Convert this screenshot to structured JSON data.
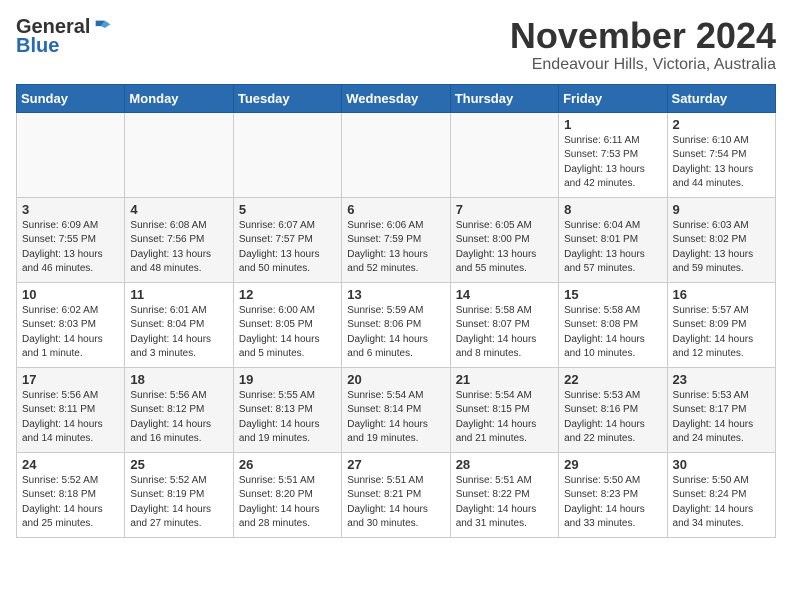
{
  "header": {
    "logo": {
      "general": "General",
      "blue": "Blue",
      "tagline": "GeneralBlue"
    },
    "title": "November 2024",
    "location": "Endeavour Hills, Victoria, Australia"
  },
  "weekdays": [
    "Sunday",
    "Monday",
    "Tuesday",
    "Wednesday",
    "Thursday",
    "Friday",
    "Saturday"
  ],
  "weeks": [
    [
      {
        "day": "",
        "info": ""
      },
      {
        "day": "",
        "info": ""
      },
      {
        "day": "",
        "info": ""
      },
      {
        "day": "",
        "info": ""
      },
      {
        "day": "",
        "info": ""
      },
      {
        "day": "1",
        "info": "Sunrise: 6:11 AM\nSunset: 7:53 PM\nDaylight: 13 hours\nand 42 minutes."
      },
      {
        "day": "2",
        "info": "Sunrise: 6:10 AM\nSunset: 7:54 PM\nDaylight: 13 hours\nand 44 minutes."
      }
    ],
    [
      {
        "day": "3",
        "info": "Sunrise: 6:09 AM\nSunset: 7:55 PM\nDaylight: 13 hours\nand 46 minutes."
      },
      {
        "day": "4",
        "info": "Sunrise: 6:08 AM\nSunset: 7:56 PM\nDaylight: 13 hours\nand 48 minutes."
      },
      {
        "day": "5",
        "info": "Sunrise: 6:07 AM\nSunset: 7:57 PM\nDaylight: 13 hours\nand 50 minutes."
      },
      {
        "day": "6",
        "info": "Sunrise: 6:06 AM\nSunset: 7:59 PM\nDaylight: 13 hours\nand 52 minutes."
      },
      {
        "day": "7",
        "info": "Sunrise: 6:05 AM\nSunset: 8:00 PM\nDaylight: 13 hours\nand 55 minutes."
      },
      {
        "day": "8",
        "info": "Sunrise: 6:04 AM\nSunset: 8:01 PM\nDaylight: 13 hours\nand 57 minutes."
      },
      {
        "day": "9",
        "info": "Sunrise: 6:03 AM\nSunset: 8:02 PM\nDaylight: 13 hours\nand 59 minutes."
      }
    ],
    [
      {
        "day": "10",
        "info": "Sunrise: 6:02 AM\nSunset: 8:03 PM\nDaylight: 14 hours\nand 1 minute."
      },
      {
        "day": "11",
        "info": "Sunrise: 6:01 AM\nSunset: 8:04 PM\nDaylight: 14 hours\nand 3 minutes."
      },
      {
        "day": "12",
        "info": "Sunrise: 6:00 AM\nSunset: 8:05 PM\nDaylight: 14 hours\nand 5 minutes."
      },
      {
        "day": "13",
        "info": "Sunrise: 5:59 AM\nSunset: 8:06 PM\nDaylight: 14 hours\nand 6 minutes."
      },
      {
        "day": "14",
        "info": "Sunrise: 5:58 AM\nSunset: 8:07 PM\nDaylight: 14 hours\nand 8 minutes."
      },
      {
        "day": "15",
        "info": "Sunrise: 5:58 AM\nSunset: 8:08 PM\nDaylight: 14 hours\nand 10 minutes."
      },
      {
        "day": "16",
        "info": "Sunrise: 5:57 AM\nSunset: 8:09 PM\nDaylight: 14 hours\nand 12 minutes."
      }
    ],
    [
      {
        "day": "17",
        "info": "Sunrise: 5:56 AM\nSunset: 8:11 PM\nDaylight: 14 hours\nand 14 minutes."
      },
      {
        "day": "18",
        "info": "Sunrise: 5:56 AM\nSunset: 8:12 PM\nDaylight: 14 hours\nand 16 minutes."
      },
      {
        "day": "19",
        "info": "Sunrise: 5:55 AM\nSunset: 8:13 PM\nDaylight: 14 hours\nand 19 minutes."
      },
      {
        "day": "20",
        "info": "Sunrise: 5:54 AM\nSunset: 8:14 PM\nDaylight: 14 hours\nand 19 minutes."
      },
      {
        "day": "21",
        "info": "Sunrise: 5:54 AM\nSunset: 8:15 PM\nDaylight: 14 hours\nand 21 minutes."
      },
      {
        "day": "22",
        "info": "Sunrise: 5:53 AM\nSunset: 8:16 PM\nDaylight: 14 hours\nand 22 minutes."
      },
      {
        "day": "23",
        "info": "Sunrise: 5:53 AM\nSunset: 8:17 PM\nDaylight: 14 hours\nand 24 minutes."
      }
    ],
    [
      {
        "day": "24",
        "info": "Sunrise: 5:52 AM\nSunset: 8:18 PM\nDaylight: 14 hours\nand 25 minutes."
      },
      {
        "day": "25",
        "info": "Sunrise: 5:52 AM\nSunset: 8:19 PM\nDaylight: 14 hours\nand 27 minutes."
      },
      {
        "day": "26",
        "info": "Sunrise: 5:51 AM\nSunset: 8:20 PM\nDaylight: 14 hours\nand 28 minutes."
      },
      {
        "day": "27",
        "info": "Sunrise: 5:51 AM\nSunset: 8:21 PM\nDaylight: 14 hours\nand 30 minutes."
      },
      {
        "day": "28",
        "info": "Sunrise: 5:51 AM\nSunset: 8:22 PM\nDaylight: 14 hours\nand 31 minutes."
      },
      {
        "day": "29",
        "info": "Sunrise: 5:50 AM\nSunset: 8:23 PM\nDaylight: 14 hours\nand 33 minutes."
      },
      {
        "day": "30",
        "info": "Sunrise: 5:50 AM\nSunset: 8:24 PM\nDaylight: 14 hours\nand 34 minutes."
      }
    ]
  ]
}
